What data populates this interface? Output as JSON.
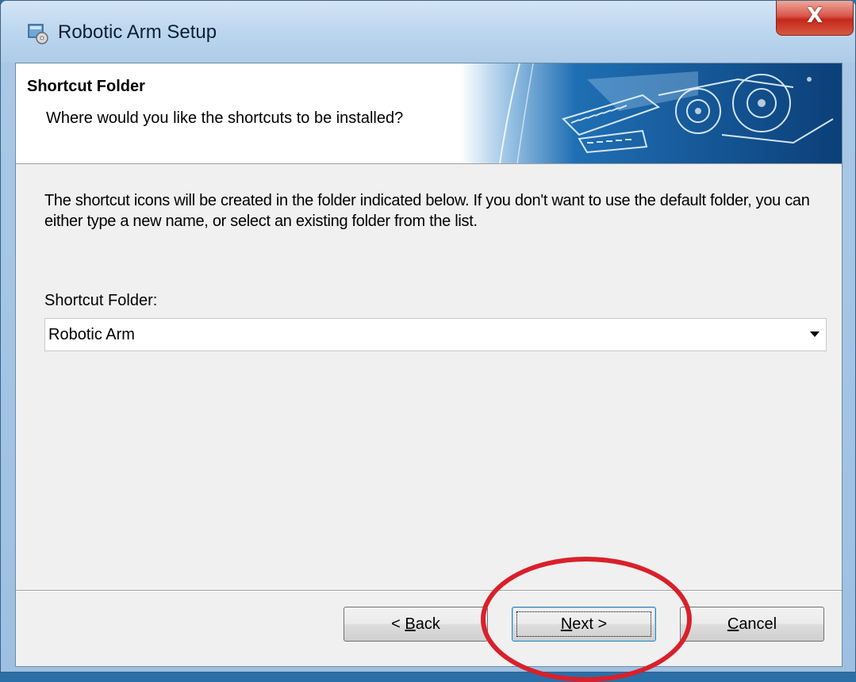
{
  "window": {
    "title": "Robotic Arm Setup",
    "close_label": "X",
    "icon": "installer-icon"
  },
  "header": {
    "title": "Shortcut Folder",
    "subtitle": "Where would you like the shortcuts to be installed?"
  },
  "body": {
    "description": "The shortcut icons will be created in the folder indicated below. If you don't want to use the default folder, you can either type a new name, or select an existing folder from the list.",
    "field_label": "Shortcut Folder:",
    "folder_value": "Robotic Arm"
  },
  "buttons": {
    "back_prefix": "< ",
    "back_mnemonic": "B",
    "back_rest": "ack",
    "next_mnemonic": "N",
    "next_rest": "ext >",
    "cancel_mnemonic": "C",
    "cancel_rest": "ancel"
  },
  "colors": {
    "annotation": "#d9202a",
    "close_button": "#c4281b",
    "title_bar": "#bcd6ee"
  }
}
